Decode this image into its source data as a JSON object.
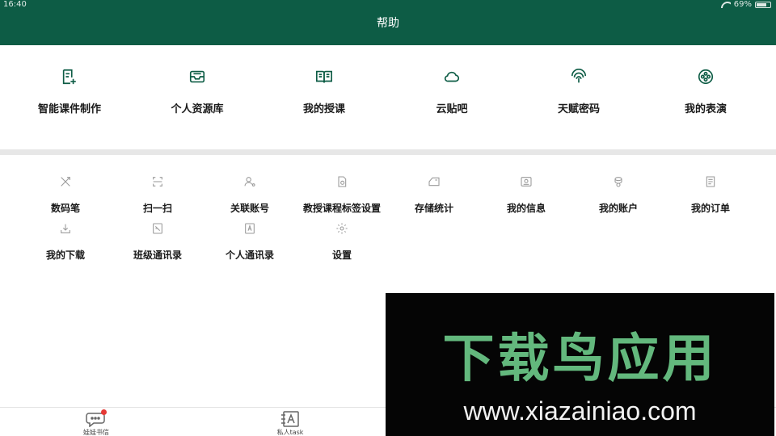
{
  "status_bar": {
    "time": "16:40",
    "battery": "69%"
  },
  "header": {
    "title": "帮助"
  },
  "top_items": [
    {
      "label": "智能课件制作",
      "icon": "document-plus-icon"
    },
    {
      "label": "个人资源库",
      "icon": "inbox-tray-icon"
    },
    {
      "label": "我的授课",
      "icon": "open-book-icon"
    },
    {
      "label": "云贴吧",
      "icon": "cloud-icon"
    },
    {
      "label": "天赋密码",
      "icon": "fingerprint-icon"
    },
    {
      "label": "我的表演",
      "icon": "film-reel-icon"
    }
  ],
  "secondary_items": [
    {
      "label": "数码笔",
      "icon": "pen-tools-icon"
    },
    {
      "label": "扫一扫",
      "icon": "scan-icon"
    },
    {
      "label": "关联账号",
      "icon": "user-link-icon"
    },
    {
      "label": "教授课程标签设置",
      "icon": "tag-settings-icon"
    },
    {
      "label": "存储统计",
      "icon": "storage-icon"
    },
    {
      "label": "我的信息",
      "icon": "id-card-icon"
    },
    {
      "label": "我的账户",
      "icon": "coins-icon"
    },
    {
      "label": "我的订单",
      "icon": "order-list-icon"
    },
    {
      "label": "我的下载",
      "icon": "download-icon"
    },
    {
      "label": "班级通讯录",
      "icon": "class-contacts-icon"
    },
    {
      "label": "个人通讯录",
      "icon": "contacts-icon"
    },
    {
      "label": "设置",
      "icon": "gear-icon"
    }
  ],
  "tabs": [
    {
      "label": "娃娃书信",
      "icon": "chat-bubble-icon",
      "has_badge": true
    },
    {
      "label": "私人task",
      "icon": "notebook-a-icon",
      "has_badge": false
    }
  ],
  "watermark": {
    "title": "下载鸟应用",
    "url": "www.xiazainiao.com"
  },
  "colors": {
    "header": "#0d5c45",
    "icon_primary": "#0d5c45",
    "icon_secondary": "#9a9a9a",
    "badge": "#e53935",
    "watermark_green": "#63b87d"
  }
}
